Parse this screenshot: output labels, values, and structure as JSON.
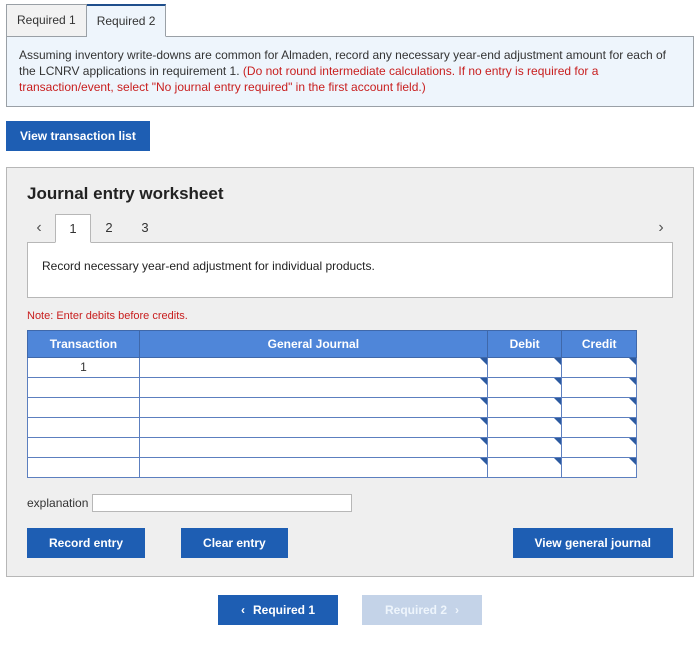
{
  "topTabs": {
    "t1": "Required 1",
    "t2": "Required 2"
  },
  "instruction": {
    "black1": "Assuming inventory write-downs are common for Almaden, record any necessary year-end adjustment amount for each of the LCNRV applications in requirement 1. ",
    "red1": "(Do not round intermediate calculations. If no entry is required for a transaction/event, select \"No journal entry required\" in the first account field.)"
  },
  "viewListBtn": "View transaction list",
  "worksheet": {
    "title": "Journal entry worksheet",
    "slides": {
      "s1": "1",
      "s2": "2",
      "s3": "3"
    },
    "slideText": "Record necessary year-end adjustment for individual products.",
    "note": "Note: Enter debits before credits.",
    "headers": {
      "trans": "Transaction",
      "gen": "General Journal",
      "debit": "Debit",
      "credit": "Credit"
    },
    "firstTrans": "1",
    "explanationLabel": "explanation",
    "buttons": {
      "record": "Record entry",
      "clear": "Clear entry",
      "view": "View general journal"
    }
  },
  "bottomNav": {
    "prev": "Required 1",
    "next": "Required 2"
  }
}
